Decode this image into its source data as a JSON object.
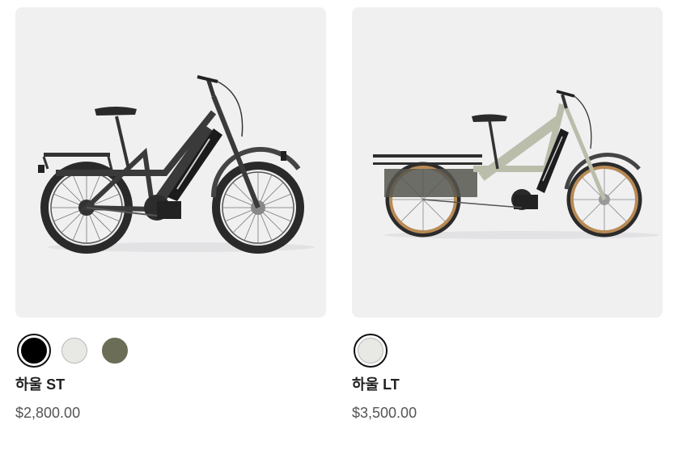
{
  "products": [
    {
      "name": "하울 ST",
      "price": "$2,800.00",
      "image_icon": "black-cargo-ebike-image",
      "swatches": [
        {
          "color": "#000000",
          "selected": true
        },
        {
          "color": "#e8e9e4",
          "selected": false
        },
        {
          "color": "#6b6d56",
          "selected": false
        }
      ]
    },
    {
      "name": "하울 LT",
      "price": "$3,500.00",
      "image_icon": "sage-longtail-cargo-ebike-image",
      "swatches": [
        {
          "color": "#e8e9e4",
          "selected": true
        }
      ]
    }
  ]
}
